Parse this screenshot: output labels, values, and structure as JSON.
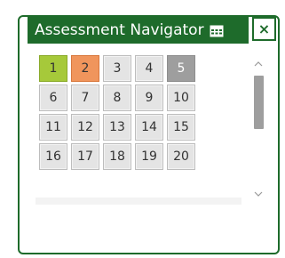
{
  "window": {
    "title": "Assessment Navigator",
    "close_label": "×"
  },
  "icons": {
    "title_icon": "grid-table-icon",
    "close": "close-icon",
    "scroll_up": "chevron-up-icon",
    "scroll_down": "chevron-down-icon"
  },
  "colors": {
    "brand": "#1e6b2b",
    "answered": "#a6c93a",
    "current": "#f0955c",
    "flagged": "#9e9e9e",
    "default": "#e4e4e4"
  },
  "questions": [
    {
      "label": "1",
      "state": "answered"
    },
    {
      "label": "2",
      "state": "current"
    },
    {
      "label": "3",
      "state": "default"
    },
    {
      "label": "4",
      "state": "default"
    },
    {
      "label": "5",
      "state": "flagged"
    },
    {
      "label": "6",
      "state": "default"
    },
    {
      "label": "7",
      "state": "default"
    },
    {
      "label": "8",
      "state": "default"
    },
    {
      "label": "9",
      "state": "default"
    },
    {
      "label": "10",
      "state": "default"
    },
    {
      "label": "11",
      "state": "default"
    },
    {
      "label": "12",
      "state": "default"
    },
    {
      "label": "13",
      "state": "default"
    },
    {
      "label": "14",
      "state": "default"
    },
    {
      "label": "15",
      "state": "default"
    },
    {
      "label": "16",
      "state": "default"
    },
    {
      "label": "17",
      "state": "default"
    },
    {
      "label": "18",
      "state": "default"
    },
    {
      "label": "19",
      "state": "default"
    },
    {
      "label": "20",
      "state": "default"
    }
  ]
}
